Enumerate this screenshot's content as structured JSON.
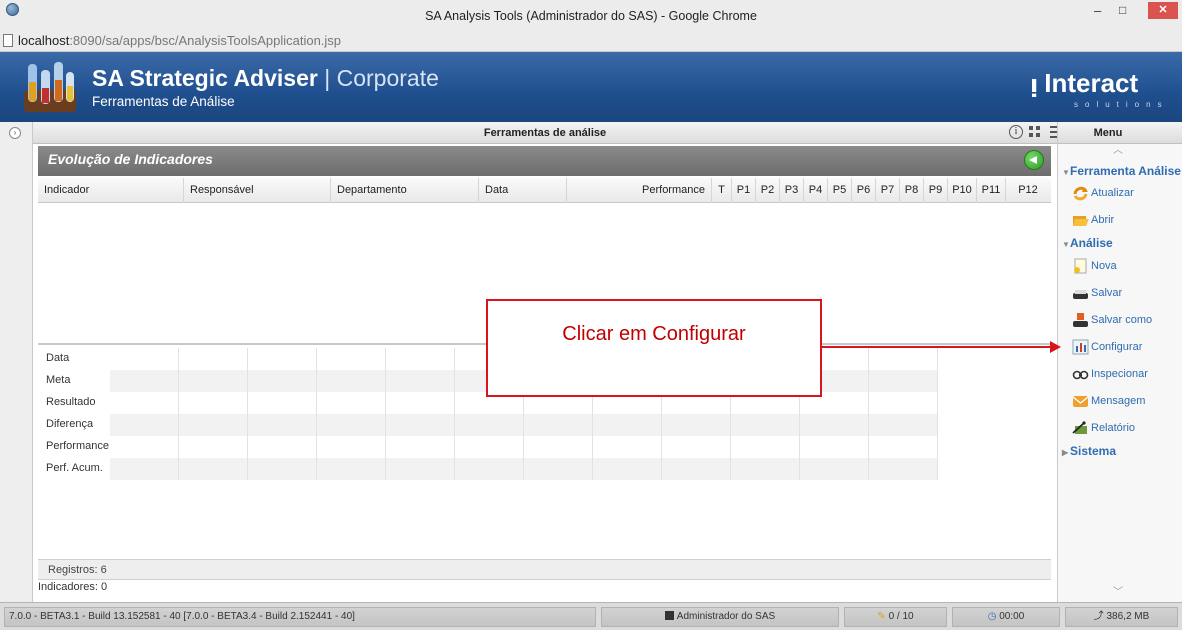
{
  "browser": {
    "window_title": "SA Analysis Tools (Administrador do SAS) - Google Chrome",
    "url_host": "localhost",
    "url_rest": ":8090/sa/apps/bsc/AnalysisToolsApplication.jsp",
    "controls": {
      "minimize": "–",
      "maximize": "□",
      "close": "✕"
    }
  },
  "header": {
    "app_name": "SA Strategic Adviser",
    "separator": "|",
    "edition": "Corporate",
    "subtitle": "Ferramentas de Análise",
    "brand": "Interact",
    "brand_sub": "solutions"
  },
  "panel": {
    "title": "Ferramentas de análise",
    "info_icon": "i",
    "section_title": "Evolução de Indicadores",
    "columns": [
      "Indicador",
      "Responsável",
      "Departamento",
      "Data",
      "Performance",
      "T",
      "P1",
      "P2",
      "P3",
      "P4",
      "P5",
      "P6",
      "P7",
      "P8",
      "P9",
      "P10",
      "P11",
      "P12"
    ],
    "row_labels": [
      "Data",
      "Meta",
      "Resultado",
      "Diferença",
      "Performance",
      "Perf. Acum."
    ],
    "registros": "Registros: 6",
    "indicadores": "Indicadores: 0"
  },
  "menu": {
    "title": "Menu",
    "groups": [
      {
        "label": "Ferramenta Análise",
        "expanded": true,
        "items": [
          {
            "label": "Atualizar",
            "icon": "refresh-icon"
          },
          {
            "label": "Abrir",
            "icon": "folder-open-icon"
          }
        ]
      },
      {
        "label": "Análise",
        "expanded": true,
        "items": [
          {
            "label": "Nova",
            "icon": "new-document-icon"
          },
          {
            "label": "Salvar",
            "icon": "save-icon"
          },
          {
            "label": "Salvar como",
            "icon": "save-as-icon"
          },
          {
            "label": "Configurar",
            "icon": "configure-icon"
          },
          {
            "label": "Inspecionar",
            "icon": "inspect-icon"
          },
          {
            "label": "Mensagem",
            "icon": "message-icon"
          },
          {
            "label": "Relatório",
            "icon": "report-icon"
          }
        ]
      },
      {
        "label": "Sistema",
        "expanded": false,
        "items": []
      }
    ]
  },
  "callout": {
    "text": "Clicar em Configurar",
    "color": "#d8141c"
  },
  "status": {
    "build": "7.0.0 - BETA3.1 - Build 13.152581 - 40 [7.0.0 - BETA3.4 - Build 2.152441 - 40]",
    "user": "Administrador do SAS",
    "tasks": "0 / 10",
    "time": "00:00",
    "memory": "386,2 MB"
  },
  "colors": {
    "banner": "#1f4f8e",
    "menu_link": "#2f6cb0",
    "section_header": "#7a7a7a"
  }
}
